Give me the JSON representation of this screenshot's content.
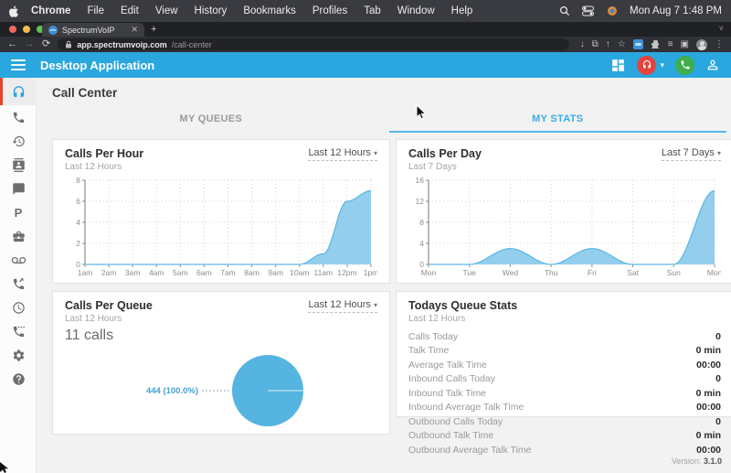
{
  "menubar": {
    "items": [
      "Chrome",
      "File",
      "Edit",
      "View",
      "History",
      "Bookmarks",
      "Profiles",
      "Tab",
      "Window",
      "Help"
    ],
    "clock": "Mon Aug 7 1:48 PM",
    "icons": [
      "apple-logo",
      "spotlight-search-icon",
      "control-center-icon",
      "menubar-extra-icon"
    ]
  },
  "browser": {
    "tab_title": "SpectrumVoIP",
    "close_tab": "✕",
    "new_tab": "+",
    "back": "←",
    "forward": "→",
    "reload": "⟳",
    "url_host": "app.spectrumvoip.com",
    "url_path": "/call-center",
    "toolbar_icons": [
      "download-icon",
      "open-in-new-icon",
      "share-icon",
      "bookmark-star-icon",
      "spectrumvoip-extension-icon",
      "extensions-puzzle-icon",
      "reading-list-icon",
      "side-panel-icon",
      "profile-avatar",
      "chrome-menu-icon"
    ],
    "glyphs": {
      "download": "↓",
      "open_in_new": "⧉",
      "share": "↑",
      "star": "☆",
      "reading_list": "≡",
      "side_panel": "▣",
      "menu": "⋮",
      "strip_chevron": "˅"
    }
  },
  "app": {
    "header_title": "Desktop Application",
    "accent": "#2aa7de",
    "page_title": "Call Center",
    "tabs": [
      {
        "label": "MY QUEUES",
        "active": false
      },
      {
        "label": "MY STATS",
        "active": true
      }
    ],
    "header_icons": [
      "apps-grid-icon",
      "agent-status-headset-icon",
      "chevron-down-icon",
      "active-call-phone-icon",
      "account-person-icon"
    ],
    "status_colors": {
      "agent_busy": "#e2453c",
      "call_active": "#3fae4b"
    },
    "version_label": "Version:",
    "version": "3.1.0"
  },
  "sidebar": {
    "icons": [
      "headset-icon",
      "phone-icon",
      "history-icon",
      "contacts-icon",
      "chat-icon",
      "park-icon",
      "device-icon",
      "voicemail-icon",
      "callback-phone-icon",
      "clock-icon",
      "conference-phone-icon",
      "settings-gear-icon",
      "help-icon"
    ],
    "park_letter": "P",
    "active_item": "call-center"
  },
  "cards": {
    "calls_per_hour": {
      "title": "Calls Per Hour",
      "subtitle": "Last 12 Hours",
      "dropdown": "Last 12 Hours",
      "caret": "▾"
    },
    "calls_per_day": {
      "title": "Calls Per Day",
      "subtitle": "Last 7 Days",
      "dropdown": "Last 7 Days",
      "caret": "▾"
    },
    "calls_per_queue": {
      "title": "Calls Per Queue",
      "subtitle": "Last 12 Hours",
      "dropdown": "Last 12 Hours",
      "caret": "▾",
      "total": "11 calls"
    },
    "queue_stats": {
      "title": "Todays Queue Stats",
      "subtitle": "Last 12 Hours",
      "rows": [
        {
          "label": "Calls Today",
          "value": "0"
        },
        {
          "label": "Talk Time",
          "value": "0 min"
        },
        {
          "label": "Average Talk Time",
          "value": "00:00"
        },
        {
          "label": "Inbound Calls Today",
          "value": "0"
        },
        {
          "label": "Inbound Talk Time",
          "value": "0 min"
        },
        {
          "label": "Inbound Average Talk Time",
          "value": "00:00"
        },
        {
          "label": "Outbound Calls Today",
          "value": "0"
        },
        {
          "label": "Outbound Talk Time",
          "value": "0 min"
        },
        {
          "label": "Outbound Average Talk Time",
          "value": "00:00"
        }
      ]
    }
  },
  "chart_data": [
    {
      "type": "area",
      "title": "Calls Per Hour",
      "x": [
        "1am",
        "2am",
        "3am",
        "4am",
        "5am",
        "6am",
        "7am",
        "8am",
        "9am",
        "10am",
        "11am",
        "12pm",
        "1pm"
      ],
      "values": [
        0,
        0,
        0,
        0,
        0,
        0,
        0,
        0,
        0,
        0,
        1,
        6,
        7
      ],
      "ylim": [
        0,
        8
      ],
      "yticks": [
        0,
        2,
        4,
        6,
        8
      ],
      "grid": "dotted",
      "fill": "#8dccec",
      "line": "#62b8e3",
      "legend": "none"
    },
    {
      "type": "area",
      "title": "Calls Per Day",
      "x": [
        "Mon",
        "Tue",
        "Wed",
        "Thu",
        "Fri",
        "Sat",
        "Sun",
        "Mon"
      ],
      "values": [
        0,
        0,
        3,
        0,
        3,
        0,
        0,
        14
      ],
      "ylim": [
        0,
        16
      ],
      "yticks": [
        0,
        4,
        8,
        12,
        16
      ],
      "grid": "dotted",
      "fill": "#8dccec",
      "line": "#62b8e3",
      "legend": "none"
    },
    {
      "type": "pie",
      "title": "Calls Per Queue",
      "total_label": "11 calls",
      "slices": [
        {
          "label": "444",
          "value": 100.0,
          "display": "444 (100.0%)",
          "color": "#55b4e0"
        }
      ],
      "label_color": "#4aa0cf"
    }
  ]
}
